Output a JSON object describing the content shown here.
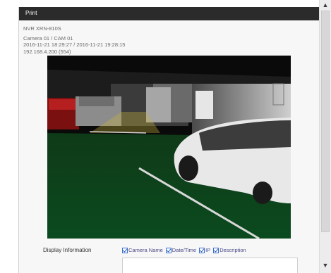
{
  "window": {
    "title": "Print"
  },
  "info": {
    "device": "NVR XRN-810S",
    "camera": "Camera 01 / CAM 01",
    "datetime": "2016-11-21 18:29:27 / 2016-11-21 19:28:15",
    "ip": "192.168.4.200 (554)"
  },
  "display": {
    "label": "Display Information",
    "options": [
      {
        "label": "Camera Name",
        "checked": true
      },
      {
        "label": "Date/Time",
        "checked": true
      },
      {
        "label": "IP",
        "checked": true
      },
      {
        "label": "Description",
        "checked": true
      }
    ]
  },
  "colors": {
    "titlebar": "#2b2b2b",
    "checkbox": "#3a6fcf"
  },
  "icons": {
    "scroll_up": "chevron-up-icon",
    "scroll_down": "chevron-down-icon"
  }
}
